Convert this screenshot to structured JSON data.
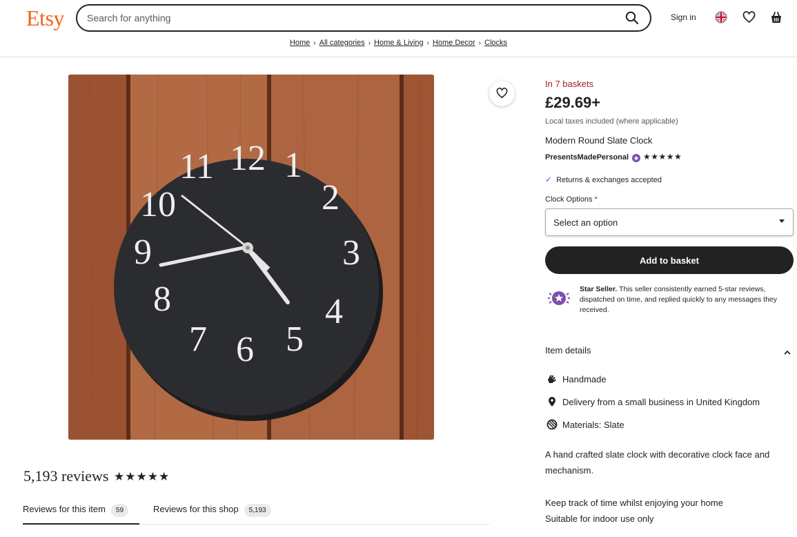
{
  "header": {
    "logo": "Etsy",
    "search_placeholder": "Search for anything",
    "signin": "Sign in"
  },
  "breadcrumb": [
    "Home",
    "All categories",
    "Home & Living",
    "Home Decor",
    "Clocks"
  ],
  "product": {
    "baskets": "In 7 baskets",
    "price": "£29.69+",
    "tax_note": "Local taxes included (where applicable)",
    "title": "Modern Round Slate Clock",
    "shop_name": "PresentsMadePersonal",
    "shop_rating": "★★★★★",
    "returns": "Returns & exchanges accepted",
    "options_label": "Clock Options",
    "options_required": "*",
    "options_selected": "Select an option",
    "add_button": "Add to basket",
    "star_seller_title": "Star Seller.",
    "star_seller_text": "This seller consistently earned 5-star reviews, dispatched on time, and replied quickly to any messages they received."
  },
  "item_details": {
    "heading": "Item details",
    "rows": [
      {
        "icon": "hand-icon",
        "label": "Handmade"
      },
      {
        "icon": "location-pin-icon",
        "label": "Delivery from a small business in United Kingdom"
      },
      {
        "icon": "materials-icon",
        "label": "Materials: Slate"
      }
    ],
    "description": [
      "A hand crafted slate clock with decorative clock face and mechanism.",
      "Keep track of time whilst enjoying your home",
      "Suitable for indoor use only"
    ]
  },
  "reviews": {
    "title": "5,193 reviews",
    "stars": "★★★★★",
    "tabs": [
      {
        "label": "Reviews for this item",
        "count": "59"
      },
      {
        "label": "Reviews for this shop",
        "count": "5,193"
      }
    ]
  },
  "clock_face": {
    "numerals": [
      "12",
      "1",
      "2",
      "3",
      "4",
      "5",
      "6",
      "7",
      "8",
      "9",
      "10",
      "11"
    ]
  },
  "colors": {
    "brand": "#f1641e",
    "baskets": "#a61a2e",
    "button": "#222222",
    "star_seller": "#7b4fb0"
  }
}
